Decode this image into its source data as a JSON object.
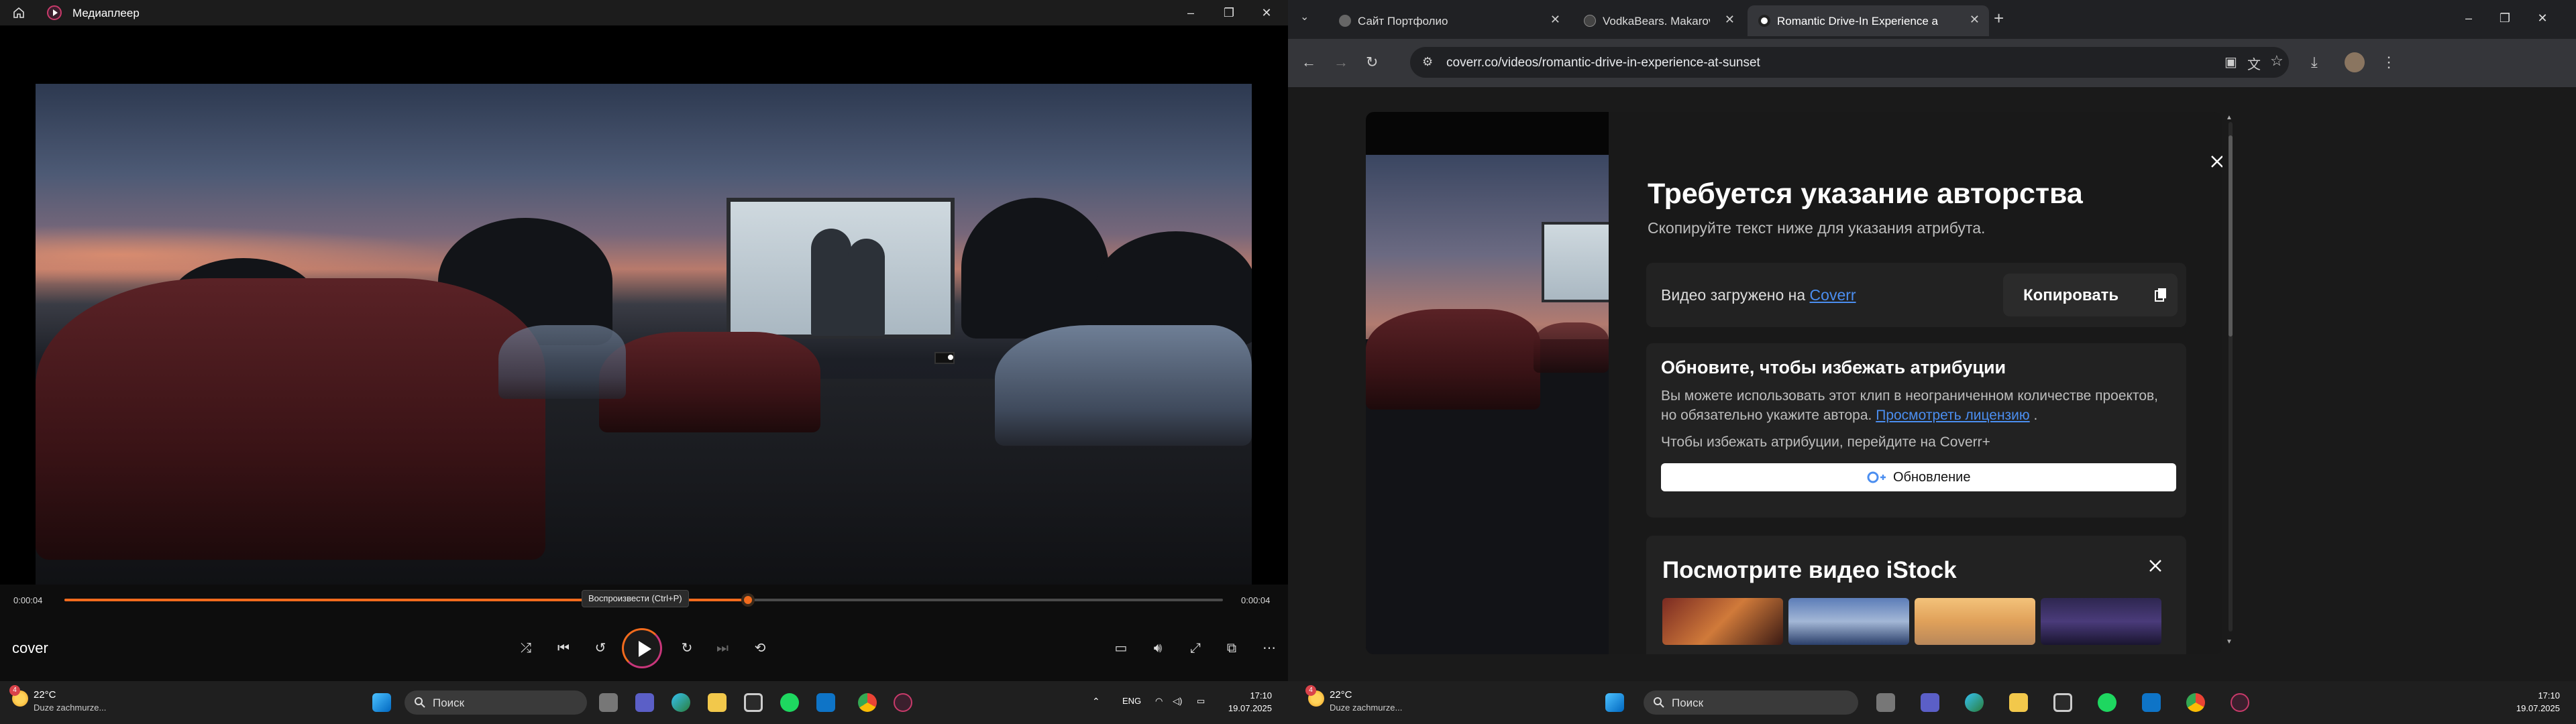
{
  "player": {
    "app_title": "Медиаплеер",
    "time_elapsed": "0:00:04",
    "time_total": "0:00:04",
    "progress_fraction": 0.59,
    "tooltip": "Воспроизвести (Ctrl+P)",
    "now_playing": "cover"
  },
  "browser": {
    "tabs": [
      {
        "label": "Сайт Портфолио",
        "active": false
      },
      {
        "label": "VodkaBears. Makarov Ilya.",
        "active": false
      },
      {
        "label": "Romantic Drive-In Experience a",
        "active": true
      }
    ],
    "url": "coverr.co/videos/romantic-drive-in-experience-at-sunset"
  },
  "modal": {
    "title": "Требуется указание авторства",
    "subtitle": "Скопируйте текст ниже для указания атрибута.",
    "credit_prefix": "Видео загружено на ",
    "credit_link": "Coverr",
    "copy_label": "Копировать",
    "upgrade_title": "Обновите, чтобы избежать атрибуции",
    "upgrade_body_1": "Вы можете использовать этот клип в неограниченном количестве проектов, но обязательно укажите автора.",
    "upgrade_link": "Просмотреть лицензию",
    "upgrade_body_2": " .",
    "upgrade_note": "Чтобы избежать атрибуции, перейдите на Coverr+",
    "upgrade_button": "Обновление",
    "istock_title": "Посмотрите видео iStock"
  },
  "taskbar_left": {
    "weather_temp": "22°C",
    "weather_cond": "Duze zachmurze...",
    "badge": "4",
    "search": "Поиск",
    "lang": "ENG",
    "time": "17:10",
    "date": "19.07.2025"
  },
  "taskbar_right": {
    "weather_temp": "22°C",
    "weather_cond": "Duze zachmurze...",
    "badge": "4",
    "search": "Поиск",
    "time": "17:10",
    "date": "19.07.2025"
  },
  "colors": {
    "accent": "#f26b1d",
    "link": "#4b8ef0"
  }
}
